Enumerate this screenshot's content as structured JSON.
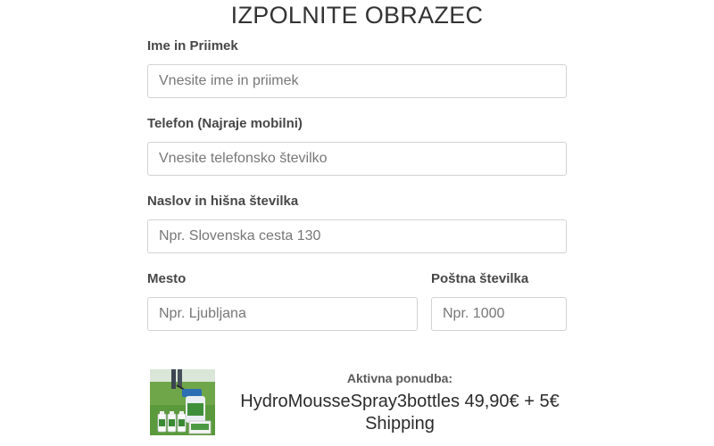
{
  "form": {
    "title": "IZPOLNITE OBRAZEC",
    "fields": {
      "name": {
        "label": "Ime in Priimek",
        "placeholder": "Vnesite ime in priimek",
        "value": ""
      },
      "phone": {
        "label": "Telefon (Najraje mobilni)",
        "placeholder": "Vnesite telefonsko številko",
        "value": ""
      },
      "address": {
        "label": "Naslov in hišna številka",
        "placeholder": "Npr. Slovenska cesta 130",
        "value": ""
      },
      "city": {
        "label": "Mesto",
        "placeholder": "Npr. Ljubljana",
        "value": ""
      },
      "postal_code": {
        "label": "Poštna številka",
        "placeholder": "Npr. 1000",
        "value": ""
      }
    }
  },
  "offer": {
    "eyebrow": "Aktivna ponudba:",
    "title": "HydroMousseSpray3bottles 49,90€ + 5€ Shipping",
    "image_icon": "product-photo-icon"
  }
}
